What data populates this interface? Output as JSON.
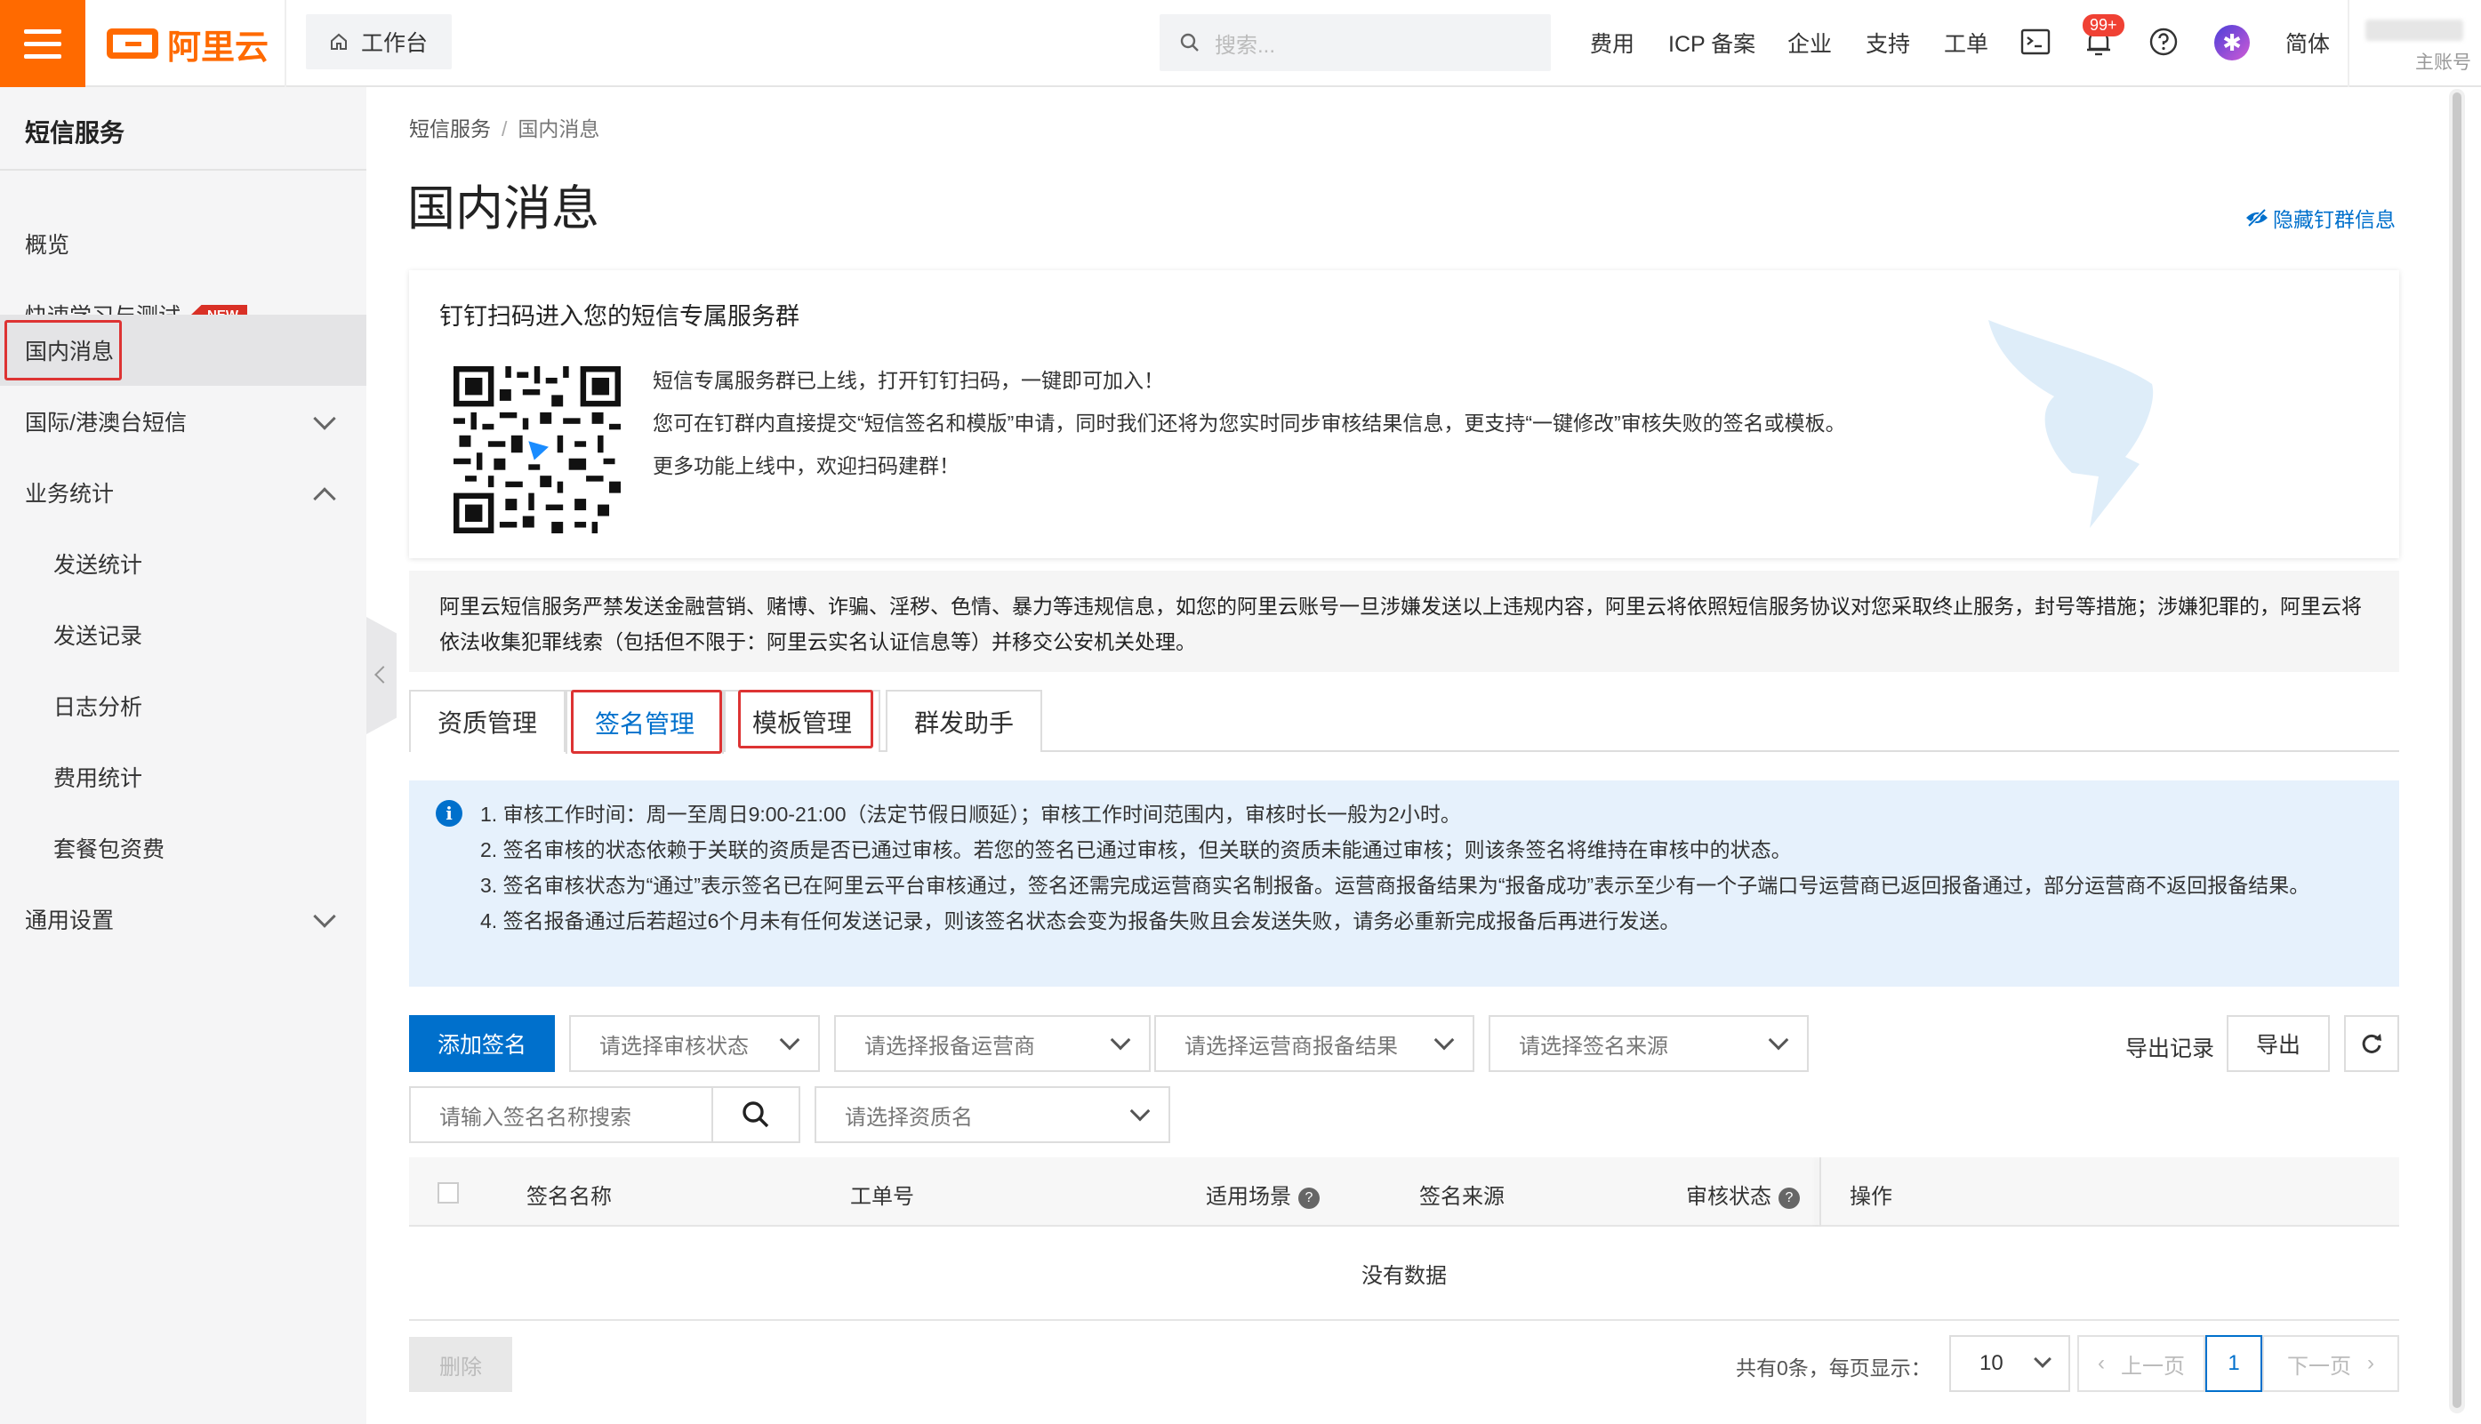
{
  "topbar": {
    "logo_text": "阿里云",
    "workbench": "工作台",
    "search_placeholder": "搜索...",
    "nav": [
      "费用",
      "ICP 备案",
      "企业",
      "支持",
      "工单"
    ],
    "notification_badge": "99+",
    "language": "简体",
    "account_sub": "主账号"
  },
  "sidebar": {
    "title": "短信服务",
    "items": [
      {
        "label": "概览"
      },
      {
        "label": "快速学习与测试",
        "badge": "NEW"
      },
      {
        "label": "国内消息"
      },
      {
        "label": "国际/港澳台短信"
      },
      {
        "label": "业务统计"
      },
      {
        "label": "发送统计"
      },
      {
        "label": "发送记录"
      },
      {
        "label": "日志分析"
      },
      {
        "label": "费用统计"
      },
      {
        "label": "套餐包资费"
      },
      {
        "label": "通用设置"
      }
    ]
  },
  "breadcrumb": [
    "短信服务",
    "国内消息"
  ],
  "page_title": "国内消息",
  "hide_link": "隐藏钉群信息",
  "ding_card": {
    "title": "钉钉扫码进入您的短信专属服务群",
    "lines": [
      "短信专属服务群已上线，打开钉钉扫码，一键即可加入！",
      "您可在钉群内直接提交“短信签名和模版”申请，同时我们还将为您实时同步审核结果信息，更支持“一键修改”审核失败的签名或模板。",
      "更多功能上线中，欢迎扫码建群！"
    ]
  },
  "warning": "阿里云短信服务严禁发送金融营销、赌博、诈骗、淫秽、色情、暴力等违规信息，如您的阿里云账号一旦涉嫌发送以上违规内容，阿里云将依照短信服务协议对您采取终止服务，封号等措施；涉嫌犯罪的，阿里云将依法收集犯罪线索（包括但不限于：阿里云实名认证信息等）并移交公安机关处理。",
  "tabs": [
    "资质管理",
    "签名管理",
    "模板管理",
    "群发助手"
  ],
  "info": [
    "1. 审核工作时间：周一至周日9:00-21:00（法定节假日顺延）；审核工作时间范围内，审核时长一般为2小时。",
    "2. 签名审核的状态依赖于关联的资质是否已通过审核。若您的签名已通过审核，但关联的资质未能通过审核；则该条签名将维持在审核中的状态。",
    "3. 签名审核状态为“通过”表示签名已在阿里云平台审核通过，签名还需完成运营商实名制报备。运营商报备结果为“报备成功”表示至少有一个子端口号运营商已返回报备通过，部分运营商不返回报备结果。",
    "4. 签名报备通过后若超过6个月未有任何发送记录，则该签名状态会变为报备失败且会发送失败，请务必重新完成报备后再进行发送。"
  ],
  "toolbar": {
    "add_button": "添加签名",
    "filters": [
      "请选择审核状态",
      "请选择报备运营商",
      "请选择运营商报备结果",
      "请选择签名来源"
    ],
    "export_records": "导出记录",
    "export": "导出",
    "search_placeholder": "请输入签名名称搜索",
    "qualification_filter": "请选择资质名"
  },
  "table": {
    "columns": [
      "签名名称",
      "工单号",
      "适用场景",
      "签名来源",
      "审核状态",
      "操作"
    ],
    "empty": "没有数据"
  },
  "footer": {
    "delete": "删除",
    "total_text": "共有0条，每页显示：",
    "page_size": "10",
    "prev": "上一页",
    "current_page": "1",
    "next": "下一页"
  },
  "colors": {
    "brand": "#ff6a00",
    "primary": "#0070cc",
    "highlight_box": "#dd3333"
  }
}
